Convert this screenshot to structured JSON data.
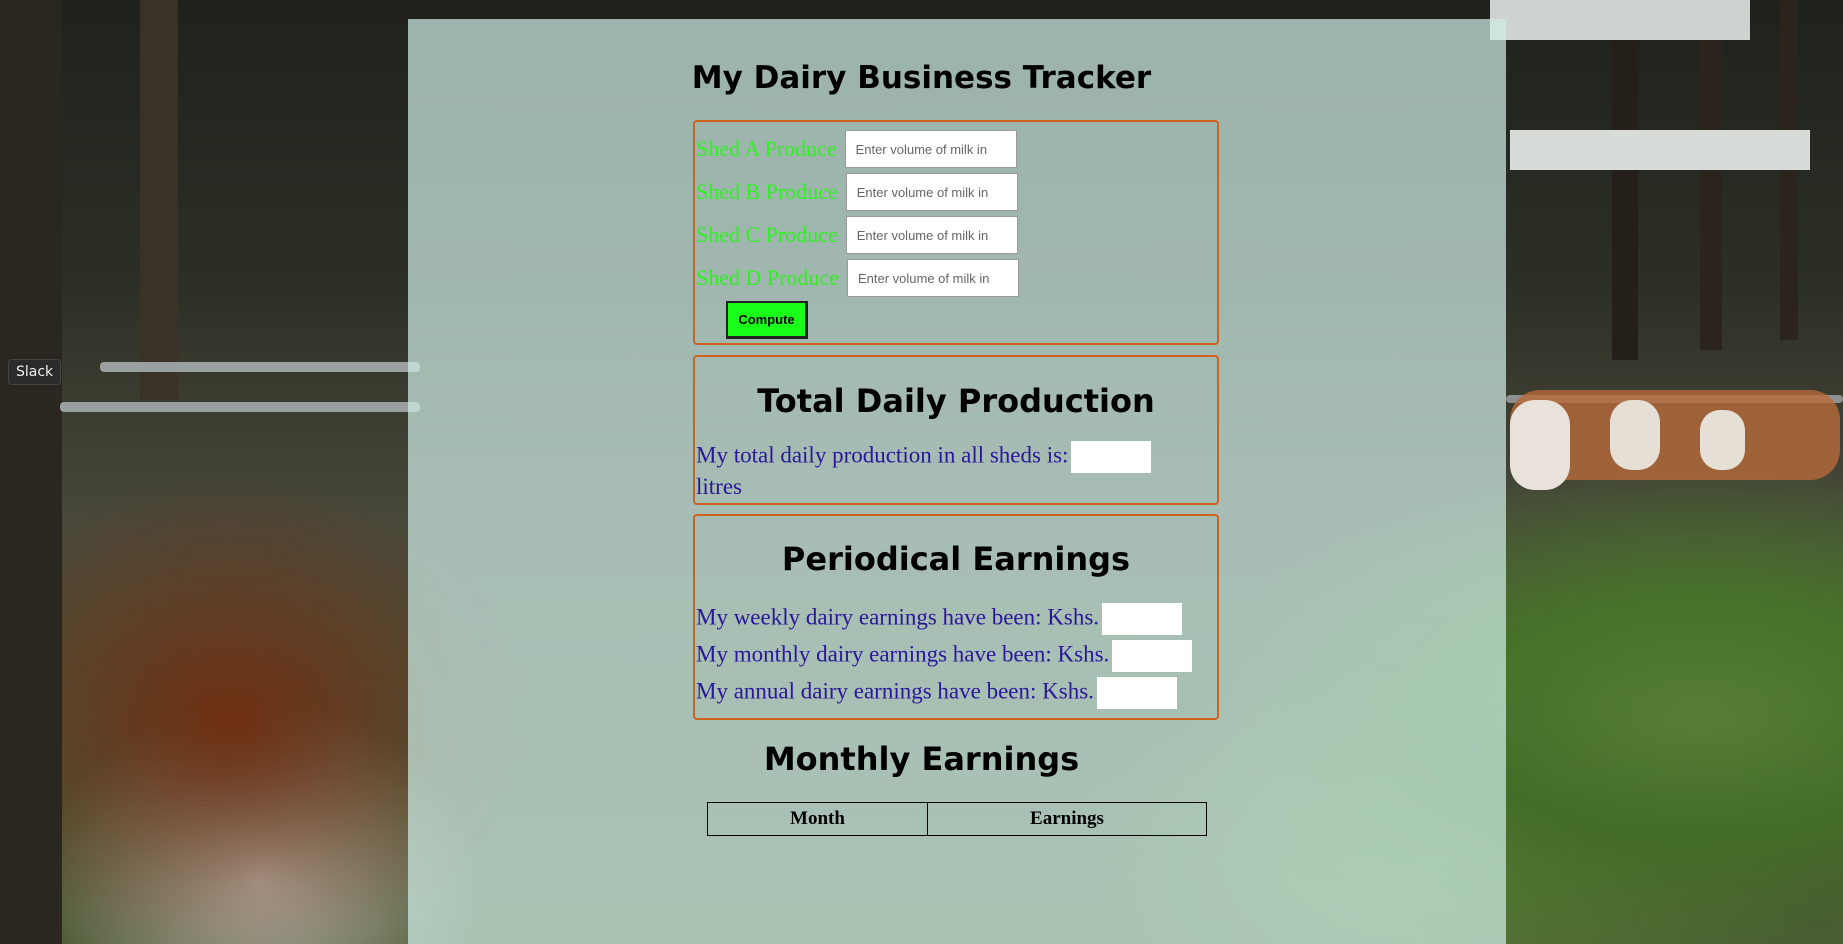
{
  "app": {
    "title": "My Dairy Business Tracker",
    "taskbar_tooltip": "Slack"
  },
  "inputs": {
    "sheds": [
      {
        "label": "Shed A Produce",
        "placeholder": "Enter volume of milk in"
      },
      {
        "label": "Shed B Produce",
        "placeholder": "Enter volume of milk in"
      },
      {
        "label": "Shed C Produce",
        "placeholder": "Enter volume of milk in"
      },
      {
        "label": "Shed D Produce",
        "placeholder": "Enter volume of milk in"
      }
    ],
    "compute_label": "Compute"
  },
  "total": {
    "title": "Total Daily Production",
    "statement": "My total daily production in all sheds is:",
    "unit": "litres"
  },
  "earnings": {
    "title": "Periodical Earnings",
    "weekly": "My weekly dairy earnings have been: Kshs.",
    "monthly": "My monthly dairy earnings have been: Kshs.",
    "annual": "My annual dairy earnings have been: Kshs."
  },
  "monthly_table": {
    "title": "Monthly Earnings",
    "headers": [
      "Month",
      "Earnings"
    ]
  },
  "colors": {
    "accent_border": "#d0621d",
    "shed_label": "#2cf21e",
    "statement_text": "#2a169a",
    "compute_button": "#1aff1a"
  }
}
